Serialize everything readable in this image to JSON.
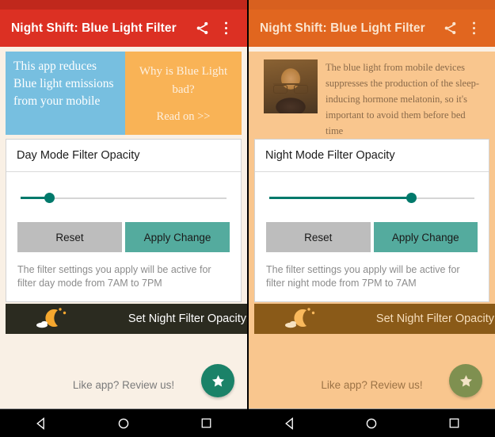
{
  "app": {
    "title": "Night Shift: Blue Light Filter",
    "share_icon": "share-icon",
    "overflow_icon": "overflow-menu-icon"
  },
  "day_panel": {
    "teaser_blue_text": "This app reduces Blue light emissions from your mobile",
    "teaser_orange_title": "Why is Blue Light bad?",
    "teaser_orange_link": "Read on >>",
    "card": {
      "header": "Day Mode Filter Opacity",
      "slider_value_pct": 14,
      "reset_label": "Reset",
      "apply_label": "Apply Change",
      "note": "The filter settings you apply will be active for filter day mode from 7AM to 7PM"
    },
    "night_bar_label": "Set Night Filter Opacity",
    "review_text": "Like app? Review us!",
    "fab_icon": "star-icon",
    "colors": {
      "status_bar": "#c0281c",
      "app_bar": "#dc3023",
      "background": "#f9f0e5",
      "night_bar": "#2b2b20",
      "fab": "#1b8268",
      "slider": "#00796b",
      "apply_button": "#54ab9e",
      "reset_button": "#bdbdbd"
    }
  },
  "night_panel": {
    "article_text": "The blue light from mobile devices suppresses the production of the sleep-inducing hormone melatonin, so it's important to avoid them before bed time",
    "portrait_alt": "author-portrait",
    "card": {
      "header": "Night Mode Filter Opacity",
      "slider_value_pct": 69,
      "reset_label": "Reset",
      "apply_label": "Apply Change",
      "note": "The filter settings you apply will be active for filter night mode from 7PM to 7AM"
    },
    "night_bar_label": "Set Night Filter Opacity",
    "review_text": "Like app? Review us!",
    "fab_icon": "star-icon",
    "colors": {
      "status_bar": "#d8601f",
      "app_bar": "#e1661f",
      "background": "#f9c68e",
      "night_bar": "#8a5a18",
      "fab": "#7f9050",
      "slider": "#00796b",
      "apply_button": "#54ab9e",
      "reset_button": "#bdbdbd"
    }
  },
  "navbar": {
    "back_icon": "back-triangle-icon",
    "home_icon": "home-circle-icon",
    "recents_icon": "recents-square-icon"
  }
}
